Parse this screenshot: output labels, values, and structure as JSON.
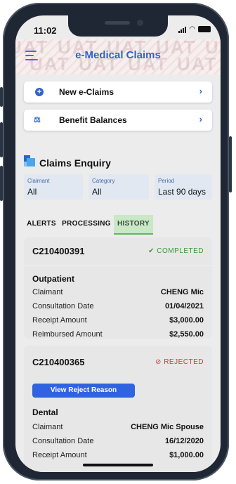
{
  "status_bar": {
    "time": "11:02"
  },
  "header": {
    "title": "e-Medical Claims",
    "watermark": "UAT"
  },
  "actions": [
    {
      "label": "New e-Claims",
      "icon": "plus-circle-icon"
    },
    {
      "label": "Benefit Balances",
      "icon": "scale-icon"
    }
  ],
  "section": {
    "title": "Claims Enquiry"
  },
  "filters": [
    {
      "caption": "Claimant",
      "value": "All"
    },
    {
      "caption": "Category",
      "value": "All"
    },
    {
      "caption": "Period",
      "value": "Last 90 days"
    }
  ],
  "tabs": [
    {
      "label": "ALERTS"
    },
    {
      "label": "PROCESSING"
    },
    {
      "label": "HISTORY",
      "active": true
    }
  ],
  "claims": [
    {
      "id": "C210400391",
      "status": "COMPLETED",
      "status_icon": "✔",
      "status_color": "#3a9a3a",
      "type": "Outpatient",
      "rows": [
        {
          "k": "Claimant",
          "v": "CHENG Mic"
        },
        {
          "k": "Consultation Date",
          "v": "01/04/2021"
        },
        {
          "k": "Receipt Amount",
          "v": "$3,000.00"
        },
        {
          "k": "Reimbursed Amount",
          "v": "$2,550.00"
        }
      ]
    },
    {
      "id": "C210400365",
      "status": "REJECTED",
      "status_icon": "⊘",
      "status_color": "#c94040",
      "button": "View Reject Reason",
      "type": "Dental",
      "rows": [
        {
          "k": "Claimant",
          "v": "CHENG Mic Spouse"
        },
        {
          "k": "Consultation Date",
          "v": "16/12/2020"
        },
        {
          "k": "Receipt Amount",
          "v": "$1,000.00"
        }
      ]
    }
  ],
  "colors": {
    "accent": "#2f63c9",
    "tab_active_bg": "#c8e8c6"
  }
}
